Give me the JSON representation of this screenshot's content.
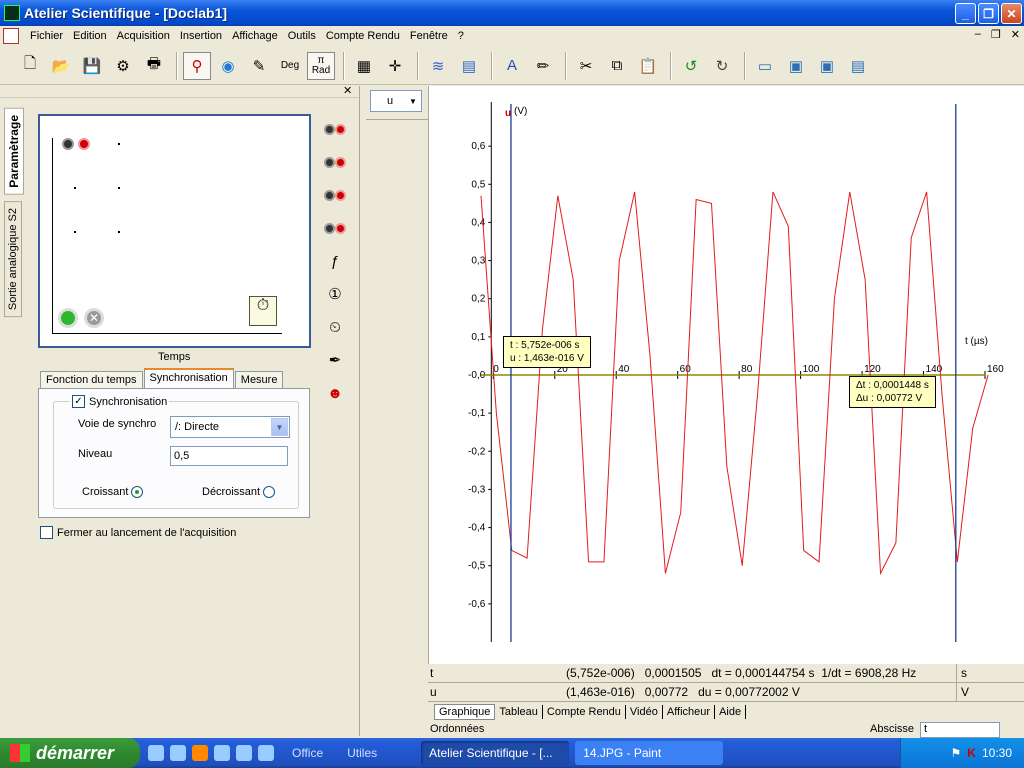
{
  "window": {
    "title": "Atelier Scientifique - [Doclab1]"
  },
  "menu": {
    "items": [
      "Fichier",
      "Edition",
      "Acquisition",
      "Insertion",
      "Affichage",
      "Outils",
      "Compte Rendu",
      "Fenêtre",
      "?"
    ]
  },
  "toolbar": {
    "deg_label": "Deg",
    "rad_pi": "π",
    "rad_label": "Rad"
  },
  "left_panel": {
    "vtabs": [
      "Paramètrage",
      "Sortie analogique S2"
    ],
    "temps_label": "Temps",
    "tabs": [
      "Fonction du temps",
      "Synchronisation",
      "Mesure"
    ],
    "sync": {
      "checkbox_label": "Synchronisation",
      "voie_label": "Voie de synchro",
      "voie_value": "/: Directe",
      "niveau_label": "Niveau",
      "niveau_value": "0,5",
      "croissant_label": "Croissant",
      "decroissant_label": "Décroissant",
      "selected": "Croissant"
    },
    "fermer_label": "Fermer au lancement de l'acquisition"
  },
  "channel_combo": {
    "value": "u"
  },
  "chart_data": {
    "type": "line",
    "ylabel_name": "u",
    "ylabel_unit": "(V)",
    "xlabel": "t (µs)",
    "xlim": [
      -4,
      160
    ],
    "ylim": [
      -0.7,
      0.7
    ],
    "x_ticks": [
      "0",
      "20",
      "40",
      "60",
      "80",
      "100",
      "120",
      "140",
      "160"
    ],
    "y_ticks": [
      "0,6",
      "0,5",
      "0,4",
      "0,3",
      "0,2",
      "0,1",
      "-0,0",
      "-0,1",
      "-0,2",
      "-0,3",
      "-0,4",
      "-0,5",
      "-0,6"
    ],
    "series": [
      {
        "color": "#e31c1c",
        "x": [
          -4,
          1,
          6,
          11,
          16,
          21,
          26,
          31,
          36,
          41,
          46,
          51,
          56,
          61,
          66,
          71,
          76,
          81,
          86,
          91,
          96,
          101,
          106,
          111,
          116,
          121,
          126,
          131,
          136,
          141,
          146,
          151,
          156,
          161
        ],
        "y": [
          0.47,
          -0.1,
          -0.46,
          -0.48,
          0.12,
          0.47,
          0.25,
          -0.49,
          -0.49,
          0.3,
          0.48,
          0.05,
          -0.52,
          -0.36,
          0.46,
          0.45,
          -0.24,
          -0.5,
          -0.05,
          0.48,
          0.39,
          -0.46,
          -0.49,
          0.2,
          0.48,
          0.25,
          -0.52,
          -0.44,
          0.36,
          0.48,
          -0.05,
          -0.49,
          -0.14,
          0
        ]
      }
    ],
    "cursors": [
      {
        "x": 5.752
      },
      {
        "x": 150.5
      }
    ],
    "tooltip1": [
      "t : 5,752e-006 s",
      "u : 1,463e-016 V"
    ],
    "tooltip2": [
      "Δt : 0,0001448 s",
      "Δu : 0,00772 V"
    ]
  },
  "status": {
    "row1": {
      "name": "t",
      "vals": "(5,752e-006)   0,0001505   dt = 0,000144754 s  1/dt = 6908,28 Hz",
      "unit": "s"
    },
    "row2": {
      "name": "u",
      "vals": "(1,463e-016)   0,00772   du = 0,00772002 V",
      "unit": "V"
    }
  },
  "bottom_tabs": [
    "Graphique",
    "Tableau",
    "Compte Rendu",
    "Vidéo",
    "Afficheur",
    "Aide"
  ],
  "ordonnees_label": "Ordonnées",
  "abscisse_label": "Abscisse",
  "abscisse_value": "t",
  "taskbar": {
    "start_label": "démarrer",
    "office_label": "Office",
    "utiles_label": "Utiles",
    "tasks": [
      "Atelier Scientifique - [...",
      "14.JPG - Paint"
    ],
    "clock": "10:30"
  }
}
